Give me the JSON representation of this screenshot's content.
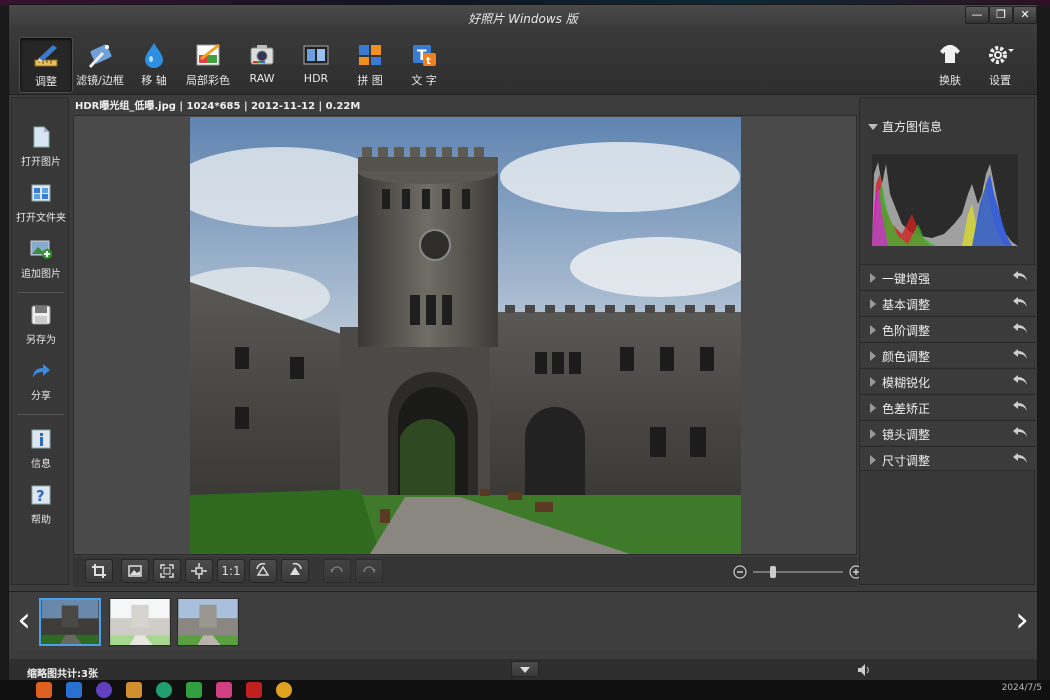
{
  "window": {
    "title": "好照片 Windows 版"
  },
  "toolbar": {
    "tools": [
      {
        "label": "调整"
      },
      {
        "label": "滤镜/边框"
      },
      {
        "label": "移 轴"
      },
      {
        "label": "局部彩色"
      },
      {
        "label": "RAW"
      },
      {
        "label": "HDR"
      },
      {
        "label": "拼 图"
      },
      {
        "label": "文 字"
      }
    ],
    "skin_label": "换肤",
    "settings_label": "设置"
  },
  "sidebar": {
    "items": [
      {
        "label": "打开图片",
        "icon": "file-icon"
      },
      {
        "label": "打开文件夹",
        "icon": "folder-icon"
      },
      {
        "label": "追加图片",
        "icon": "add-image-icon"
      },
      {
        "label": "另存为",
        "icon": "save-icon"
      },
      {
        "label": "分享",
        "icon": "share-icon"
      },
      {
        "label": "信息",
        "icon": "info-icon"
      },
      {
        "label": "帮助",
        "icon": "help-icon"
      }
    ]
  },
  "image": {
    "info": "HDR曝光组_低曝.jpg | 1024*685 | 2012-11-12 | 0.22M"
  },
  "bottom_toolbar": {
    "one_to_one": "1:1",
    "zoom_level": 0.2
  },
  "right_panel": {
    "histogram_title": "直方图信息",
    "sections": [
      {
        "label": "一键增强"
      },
      {
        "label": "基本调整"
      },
      {
        "label": "色阶调整"
      },
      {
        "label": "颜色调整"
      },
      {
        "label": "模糊锐化"
      },
      {
        "label": "色差矫正"
      },
      {
        "label": "镜头调整"
      },
      {
        "label": "尺寸调整"
      }
    ]
  },
  "filmstrip": {
    "count_text": "缩略图共计:3张"
  },
  "taskbar": {
    "date": "2024/7/5"
  },
  "colors": {
    "accent": "#4aa0e8",
    "background": "#3c3c3c"
  }
}
